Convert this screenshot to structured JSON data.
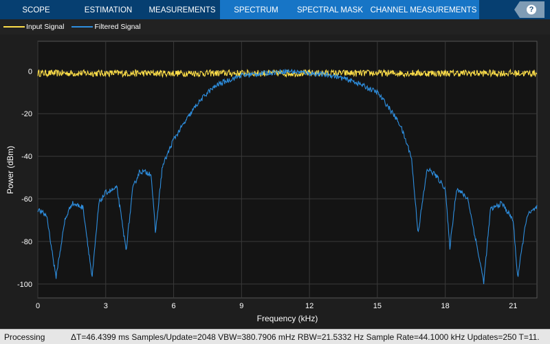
{
  "tabs": [
    "SCOPE",
    "ESTIMATION",
    "MEASUREMENTS",
    "SPECTRUM",
    "SPECTRAL MASK",
    "CHANNEL MEASUREMENTS"
  ],
  "active_tab": "SPECTRUM",
  "help_label": "?",
  "status": {
    "state": "Processing",
    "readout": "ΔT=46.4399 ms  Samples/Update=2048  VBW=380.7906 mHz  RBW=21.5332 Hz  Sample Rate=44.1000 kHz  Updates=250  T=11."
  },
  "chart_data": {
    "type": "line",
    "xlabel": "Frequency (kHz)",
    "ylabel": "Power (dBm)",
    "xlim": [
      0,
      22.05
    ],
    "ylim": [
      -106.5,
      14
    ],
    "xticks": [
      0,
      3,
      6,
      9,
      12,
      15,
      18,
      21
    ],
    "yticks": [
      0,
      -20,
      -40,
      -60,
      -80,
      -100
    ],
    "grid": true,
    "legend": "top-left",
    "background": "#141414",
    "series": [
      {
        "name": "Input Signal",
        "color": "#ffe04a",
        "x": [
          0,
          22.05
        ],
        "y": [
          -1,
          -1
        ]
      },
      {
        "name": "Filtered Signal",
        "color": "#2e8fe0",
        "x": [
          0,
          0.4,
          0.8,
          1.2,
          1.5,
          2,
          2.4,
          2.7,
          3,
          3.5,
          3.9,
          4.2,
          4.5,
          5,
          5.2,
          5.5,
          6,
          6.5,
          7,
          7.5,
          8,
          9,
          10,
          11,
          12,
          13,
          14,
          15,
          15.5,
          16,
          16.5,
          16.8,
          17.2,
          17.5,
          18,
          18.2,
          18.5,
          19,
          19.7,
          20,
          20.5,
          21,
          21.2,
          21.6,
          22.05
        ],
        "y": [
          -65,
          -68,
          -97,
          -70,
          -62,
          -64,
          -97,
          -62,
          -57,
          -55,
          -84,
          -55,
          -47,
          -48,
          -76,
          -45,
          -32,
          -24,
          -16,
          -10,
          -6,
          -2,
          -1,
          0,
          -1,
          -2,
          -5,
          -10,
          -17,
          -25,
          -40,
          -76,
          -46,
          -48,
          -55,
          -83,
          -55,
          -60,
          -99,
          -65,
          -62,
          -70,
          -97,
          -68,
          -64
        ]
      }
    ]
  }
}
